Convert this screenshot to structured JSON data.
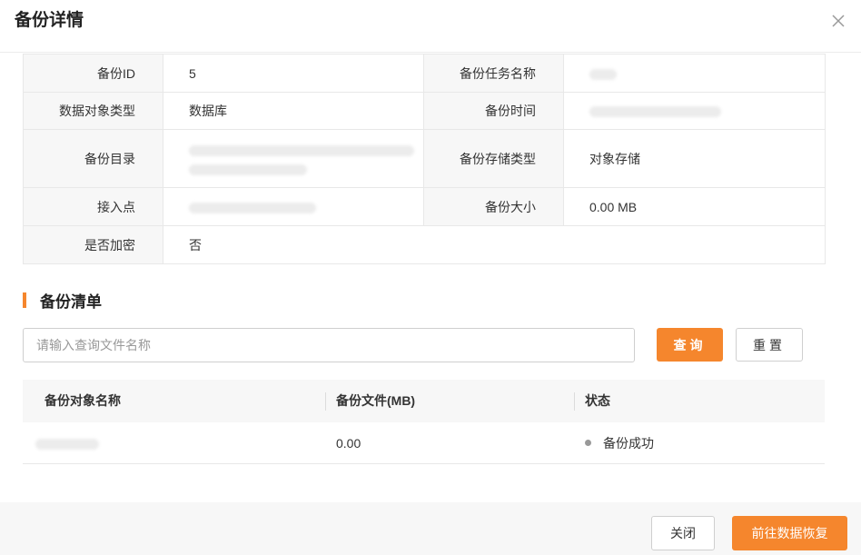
{
  "dialog": {
    "title": "备份详情",
    "close_icon": "close-icon"
  },
  "details": {
    "backup_id_label": "备份ID",
    "backup_id_value": "5",
    "task_name_label": "备份任务名称",
    "data_object_type_label": "数据对象类型",
    "data_object_type_value": "数据库",
    "backup_time_label": "备份时间",
    "backup_dir_label": "备份目录",
    "storage_type_label": "备份存储类型",
    "storage_type_value": "对象存储",
    "access_point_label": "接入点",
    "backup_size_label": "备份大小",
    "backup_size_value": "0.00 MB",
    "encrypted_label": "是否加密",
    "encrypted_value": "否"
  },
  "backup_list": {
    "section_title": "备份清单",
    "section_accent": "#f5862d",
    "search_placeholder": "请输入查询文件名称",
    "search_value": "",
    "query_button": "查询",
    "reset_button": "重置",
    "columns": [
      "备份对象名称",
      "备份文件(MB)",
      "状态"
    ],
    "rows": [
      {
        "name": "",
        "size": "0.00",
        "status": "备份成功"
      }
    ]
  },
  "footer": {
    "close_button": "关闭",
    "restore_button": "前往数据恢复",
    "primary_color": "#f5862d"
  }
}
